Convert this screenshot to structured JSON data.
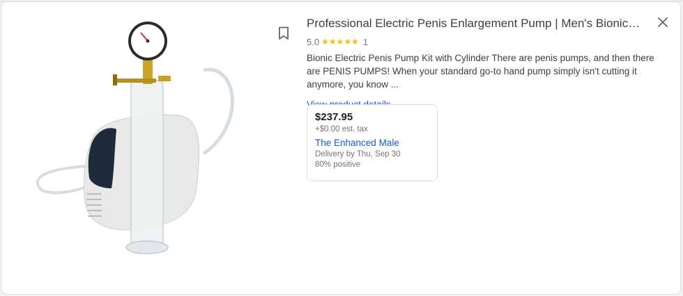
{
  "product": {
    "title": "Professional Electric Penis Enlargement Pump | Men's Bionic Pumpi...",
    "rating": "5.0",
    "stars": "★★★★★",
    "review_count": "1",
    "description": "Bionic Electric Penis Pump Kit with Cylinder There are penis pumps, and then there are PENIS PUMPS! When your standard go-to hand pump simply isn't cutting it anymore, you know ...",
    "view_details_label": "View product details"
  },
  "offer": {
    "price": "$237.95",
    "tax": "+$0.00 est. tax",
    "merchant": "The Enhanced Male",
    "delivery": "Delivery by Thu, Sep 30",
    "positive": "80% positive"
  },
  "icons": {
    "bookmark": "bookmark-icon",
    "close": "close-icon"
  },
  "colors": {
    "link": "#1558d6",
    "star": "#fbbc04",
    "secondary_text": "#70757a"
  }
}
